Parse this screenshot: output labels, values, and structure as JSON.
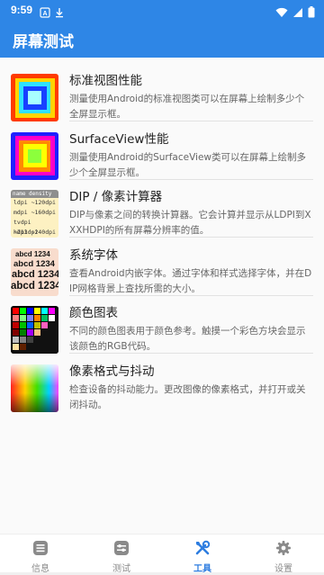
{
  "status": {
    "time": "9:59"
  },
  "appbar": {
    "title": "屏幕测试"
  },
  "items": [
    {
      "title": "标准视图性能",
      "desc": "测量使用Android的标准视图类可以在屏幕上绘制多少个全屏显示框。"
    },
    {
      "title": "SurfaceView性能",
      "desc": "测量使用Android的SurfaceView类可以在屏幕上绘制多少个全屏显示框。"
    },
    {
      "title": "DIP / 像素计算器",
      "desc": "DIP与像素之间的转换计算器。它会计算并显示从LDPI到XXXHDPI的所有屏幕分辨率的值。"
    },
    {
      "title": "系统字体",
      "desc": "查看Android内嵌字体。通过字体和样式选择字体，并在DIP网格背景上查找所需的大小。"
    },
    {
      "title": "颜色图表",
      "desc": "不同的颜色图表用于颜色参考。触摸一个彩色方块会显示该颜色的RGB代码。"
    },
    {
      "title": "像素格式与抖动",
      "desc": "检查设备的抖动能力。更改图像的像素格式，并打开或关闭抖动。"
    }
  ],
  "dip_thumb": {
    "header": "name  density",
    "rows": [
      "ldpi   ~120dpi",
      "mdpi   ~160dpi",
      "tvdpi  ~213dpi",
      "hdpi   ~240dpi"
    ]
  },
  "font_thumb": {
    "sample": "abcd 1234"
  },
  "nav": [
    {
      "label": "信息",
      "icon": "info-list-icon"
    },
    {
      "label": "测试",
      "icon": "sliders-icon"
    },
    {
      "label": "工具",
      "icon": "tools-icon",
      "active": true
    },
    {
      "label": "设置",
      "icon": "gear-icon"
    }
  ],
  "colors": {
    "primary": "#2e86e6",
    "nav_active": "#2e7de0"
  }
}
